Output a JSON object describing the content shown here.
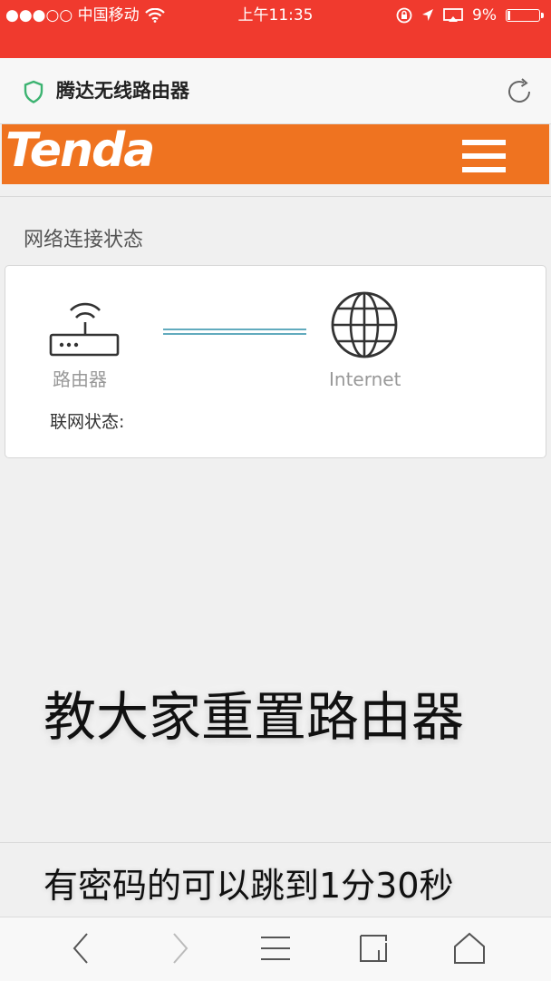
{
  "status_bar": {
    "carrier": "●●●○○ 中国移动",
    "time": "上午11:35",
    "battery_percent": "9%",
    "battery_level": 0.09
  },
  "browser": {
    "page_title": "腾达无线路由器"
  },
  "router_page": {
    "brand": "Tenda",
    "brand_color": "#ef7320",
    "section_title": "网络连接状态",
    "router_label": "路由器",
    "internet_label": "Internet",
    "connection_status_label": "联网状态:"
  },
  "captions": {
    "main": "教大家重置路由器",
    "sub": "有密码的可以跳到1分30秒"
  },
  "icons": [
    "wifi-icon",
    "lock-rotation-icon",
    "location-arrow-icon",
    "screen-mirror-icon",
    "battery-icon",
    "shield-icon",
    "reload-icon",
    "menu-icon",
    "router-icon",
    "globe-icon",
    "back-icon",
    "forward-icon",
    "menu-list-icon",
    "tabs-icon",
    "home-icon"
  ],
  "colors": {
    "status_bar": "#f03a2e",
    "shield_green": "#3cb371"
  }
}
